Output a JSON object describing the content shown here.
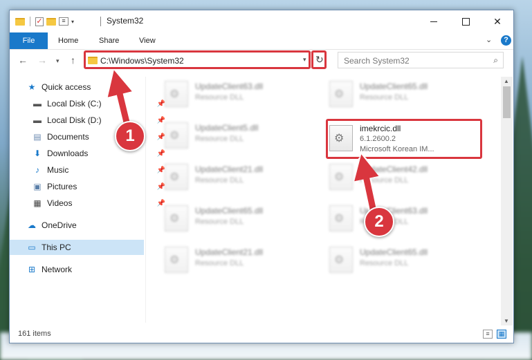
{
  "window": {
    "title": "System32",
    "controls": {
      "minimize": "",
      "maximize": "",
      "close": "✕"
    }
  },
  "ribbon": {
    "tabs": [
      "File",
      "Home",
      "Share",
      "View"
    ]
  },
  "navigation": {
    "address_path": "C:\\Windows\\System32",
    "search_placeholder": "Search System32"
  },
  "sidebar": {
    "items": [
      {
        "label": "Quick access",
        "icon": "star-icon",
        "pinned": false
      },
      {
        "label": "Local Disk (C:)",
        "icon": "drive-icon",
        "pinned": true
      },
      {
        "label": "Local Disk (D:)",
        "icon": "drive-icon",
        "pinned": true
      },
      {
        "label": "Documents",
        "icon": "documents-icon",
        "pinned": true
      },
      {
        "label": "Downloads",
        "icon": "download-icon",
        "pinned": true
      },
      {
        "label": "Music",
        "icon": "music-icon",
        "pinned": true
      },
      {
        "label": "Pictures",
        "icon": "pictures-icon",
        "pinned": true
      },
      {
        "label": "Videos",
        "icon": "videos-icon",
        "pinned": true
      },
      {
        "label": "OneDrive",
        "icon": "cloud-icon",
        "pinned": false
      },
      {
        "label": "This PC",
        "icon": "computer-icon",
        "pinned": false,
        "selected": true
      },
      {
        "label": "Network",
        "icon": "network-icon",
        "pinned": false
      }
    ]
  },
  "files": {
    "left_column": [
      {
        "name": "UpdateClient63.dll",
        "type": "Resource DLL"
      },
      {
        "name": "UpdateClient5.dll",
        "type": "Resource DLL"
      },
      {
        "name": "UpdateClient21.dll",
        "type": "Resource DLL"
      },
      {
        "name": "UpdateClient65.dll",
        "type": "Resource DLL"
      },
      {
        "name": "UpdateClient21.dll",
        "type": "Resource DLL"
      }
    ],
    "right_column": [
      {
        "name": "UpdateClient65.dll",
        "type": "Resource DLL"
      },
      {
        "name": "imekrcic.dll",
        "version": "6.1.2600.2",
        "description": "Microsoft Korean IM..."
      },
      {
        "name": "UpdateClient42.dll",
        "type": "Resource DLL"
      },
      {
        "name": "UpdateClient63.dll",
        "type": "Resource DLL"
      },
      {
        "name": "UpdateClient65.dll",
        "type": "Resource DLL"
      }
    ]
  },
  "status": {
    "item_count": "161 items"
  },
  "annotations": {
    "step1": "1",
    "step2": "2",
    "color": "#d9363e"
  }
}
